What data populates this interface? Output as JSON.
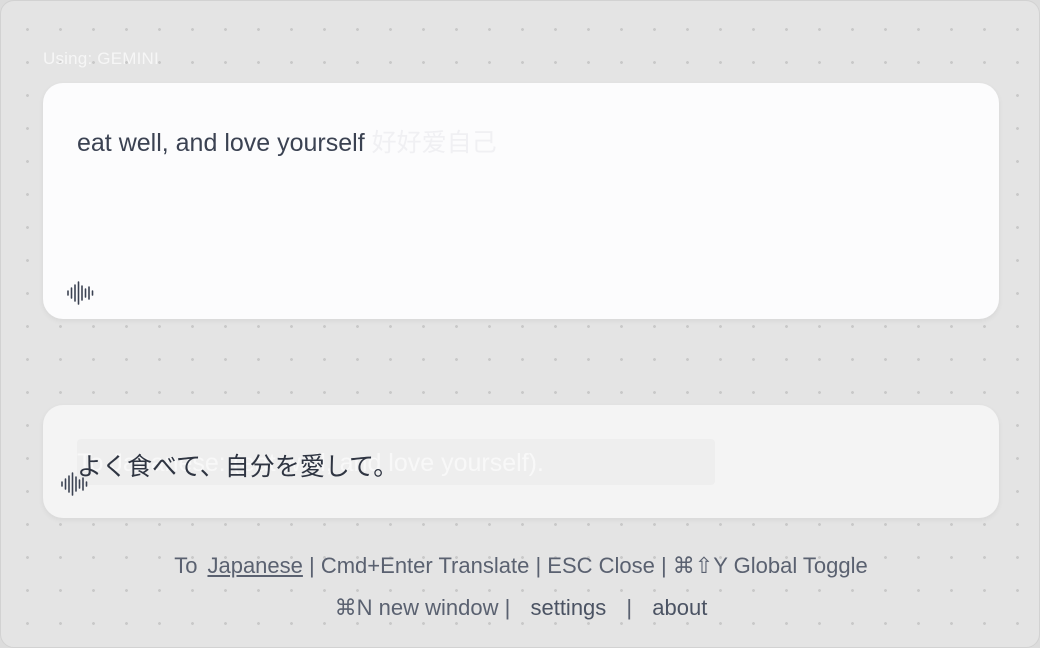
{
  "provider_label": "Using: GEMINI",
  "input": {
    "text": "eat well, and love yourself",
    "ghost_text": "好好爱自己"
  },
  "output": {
    "text": "よく食べて、自分を愛して。",
    "ghost_text": "To Japanese: (eat well, and love yourself)."
  },
  "footer": {
    "to_label": "To",
    "target_language": "Japanese",
    "shortcuts": "| Cmd+Enter Translate | ESC Close | ⌘⇧Y Global Toggle",
    "new_window": "⌘N new window |",
    "settings": "settings",
    "separator": "|",
    "about": "about"
  },
  "icons": {
    "speak_input": "sound-wave-icon",
    "speak_output": "sound-wave-icon"
  },
  "colors": {
    "text_primary": "#3b4252",
    "footer_text": "#5a6170",
    "window_bg": "#e4e4e4",
    "card_bg": "#fcfcfd"
  }
}
